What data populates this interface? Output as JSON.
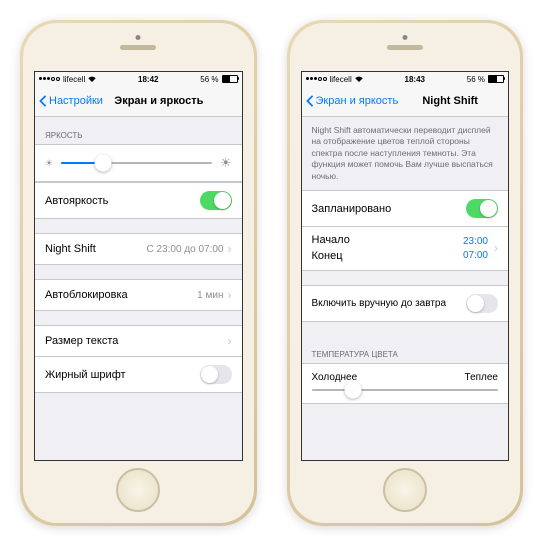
{
  "phone1": {
    "status": {
      "carrier": "lifecell",
      "time": "18:42",
      "battery": "56 %"
    },
    "nav": {
      "back": "Настройки",
      "title": "Экран и яркость"
    },
    "brightness": {
      "header": "ЯРКОСТЬ",
      "auto_label": "Автояркость",
      "slider_pct": 28
    },
    "nightshift": {
      "label": "Night Shift",
      "detail": "С 23:00 до 07:00"
    },
    "autolock": {
      "label": "Автоблокировка",
      "detail": "1 мин"
    },
    "textsize": {
      "label": "Размер текста"
    },
    "bold": {
      "label": "Жирный шрифт"
    }
  },
  "phone2": {
    "status": {
      "carrier": "lifecell",
      "time": "18:43",
      "battery": "56 %"
    },
    "nav": {
      "back": "Экран и яркость",
      "title": "Night Shift"
    },
    "desc": "Night Shift автоматически переводит дисплей на отображение цветов теплой стороны спектра после наступления темноты. Эта функция может помочь Вам лучше выспаться ночью.",
    "scheduled": {
      "label": "Запланировано"
    },
    "times": {
      "from_label": "Начало",
      "to_label": "Конец",
      "from": "23:00",
      "to": "07:00"
    },
    "manual": {
      "label": "Включить вручную до завтра"
    },
    "temp": {
      "header": "ТЕМПЕРАТУРА ЦВЕТА",
      "cold": "Холоднее",
      "warm": "Теплее",
      "slider_pct": 22
    }
  }
}
